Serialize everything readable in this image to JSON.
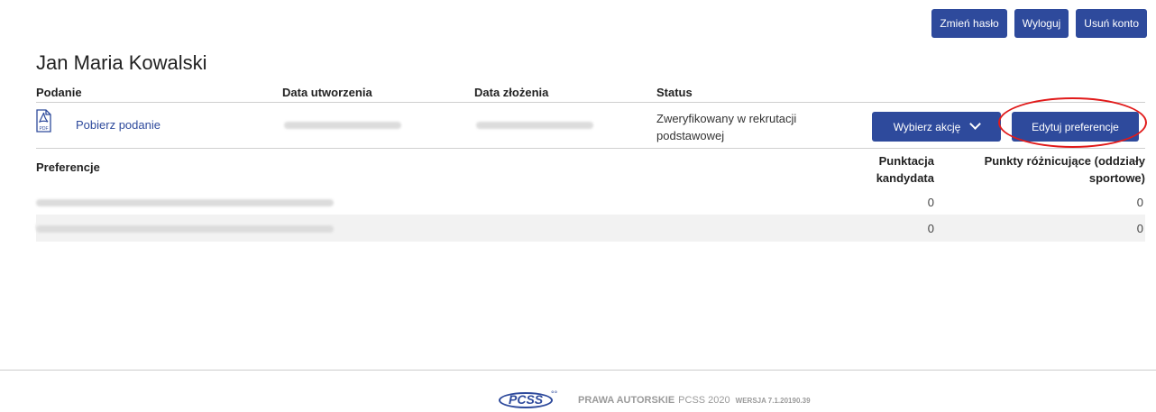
{
  "header": {
    "buttons": {
      "change_password": "Zmień hasło",
      "logout": "Wyloguj",
      "delete_account": "Usuń konto"
    }
  },
  "user": {
    "name": "Jan Maria Kowalski"
  },
  "applications_table": {
    "columns": [
      "Podanie",
      "Data utworzenia",
      "Data złożenia",
      "Status"
    ],
    "row": {
      "download_link": "Pobierz podanie",
      "status": "Zweryfikowany w rekrutacji podstawowej",
      "actions_dropdown": "Wybierz akcję",
      "edit_preferences_button": "Edytuj preferencje",
      "icon": "pdf-icon"
    }
  },
  "preferences_table": {
    "columns": {
      "preferences": "Preferencje",
      "candidate_points": "Punktacja kandydata",
      "difference_points": "Punkty różnicujące (oddziały sportowe)"
    },
    "rows": [
      {
        "candidate_points": "0",
        "difference_points": "0"
      },
      {
        "candidate_points": "0",
        "difference_points": "0"
      }
    ]
  },
  "footer": {
    "logo": "PCSS",
    "copyright_label": "PRAWA AUTORSKIE",
    "copyright_value": "PCSS 2020",
    "version_label": "WERSJA 7.1.20190.39"
  },
  "colors": {
    "accent": "#2e4a9c",
    "highlight": "#e11a1a",
    "row_stripe": "#f2f2f2"
  }
}
